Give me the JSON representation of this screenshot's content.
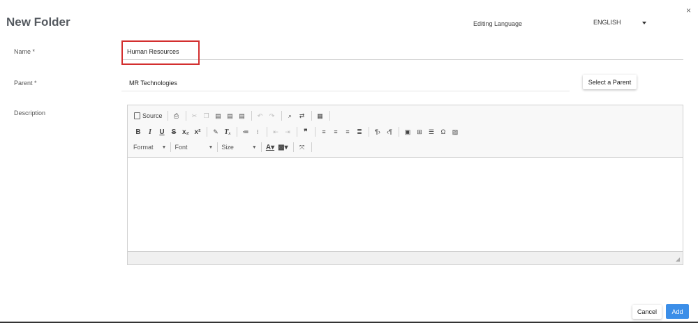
{
  "dialog": {
    "title": "New Folder",
    "close_glyph": "×"
  },
  "language": {
    "label": "Editing Language",
    "selected": "ENGLISH"
  },
  "form": {
    "name_label": "Name *",
    "name_value": "Human Resources",
    "parent_label": "Parent *",
    "parent_value": "MR Technologies",
    "select_parent_label": "Select a Parent",
    "description_label": "Description"
  },
  "editor": {
    "toolbar": {
      "source_label": "Source",
      "format_label": "Format",
      "font_label": "Font",
      "size_label": "Size",
      "row1_icons": [
        "source-icon",
        "print-icon",
        "cut-icon",
        "copy-icon",
        "paste-icon",
        "paste-text-icon",
        "paste-word-icon",
        "undo-icon",
        "redo-icon",
        "find-icon",
        "replace-icon",
        "templates-icon"
      ],
      "row2_icons": [
        "bold-icon",
        "italic-icon",
        "underline-icon",
        "strikethrough-icon",
        "subscript-icon",
        "superscript-icon",
        "remove-format-icon",
        "clear-format-icon",
        "numbered-list-icon",
        "bulleted-list-icon",
        "outdent-icon",
        "indent-icon",
        "blockquote-icon",
        "align-left-icon",
        "align-center-icon",
        "align-right-icon",
        "justify-icon",
        "ltr-icon",
        "rtl-icon",
        "flash-icon",
        "table-icon",
        "horizontal-line-icon",
        "special-char-icon",
        "image-icon"
      ],
      "row3_icons": [
        "text-color-icon",
        "background-color-icon",
        "maximize-icon"
      ]
    }
  },
  "footer": {
    "cancel_label": "Cancel",
    "add_label": "Add"
  },
  "colors": {
    "primary": "#3b8ee8",
    "highlight": "#d32f2f"
  }
}
